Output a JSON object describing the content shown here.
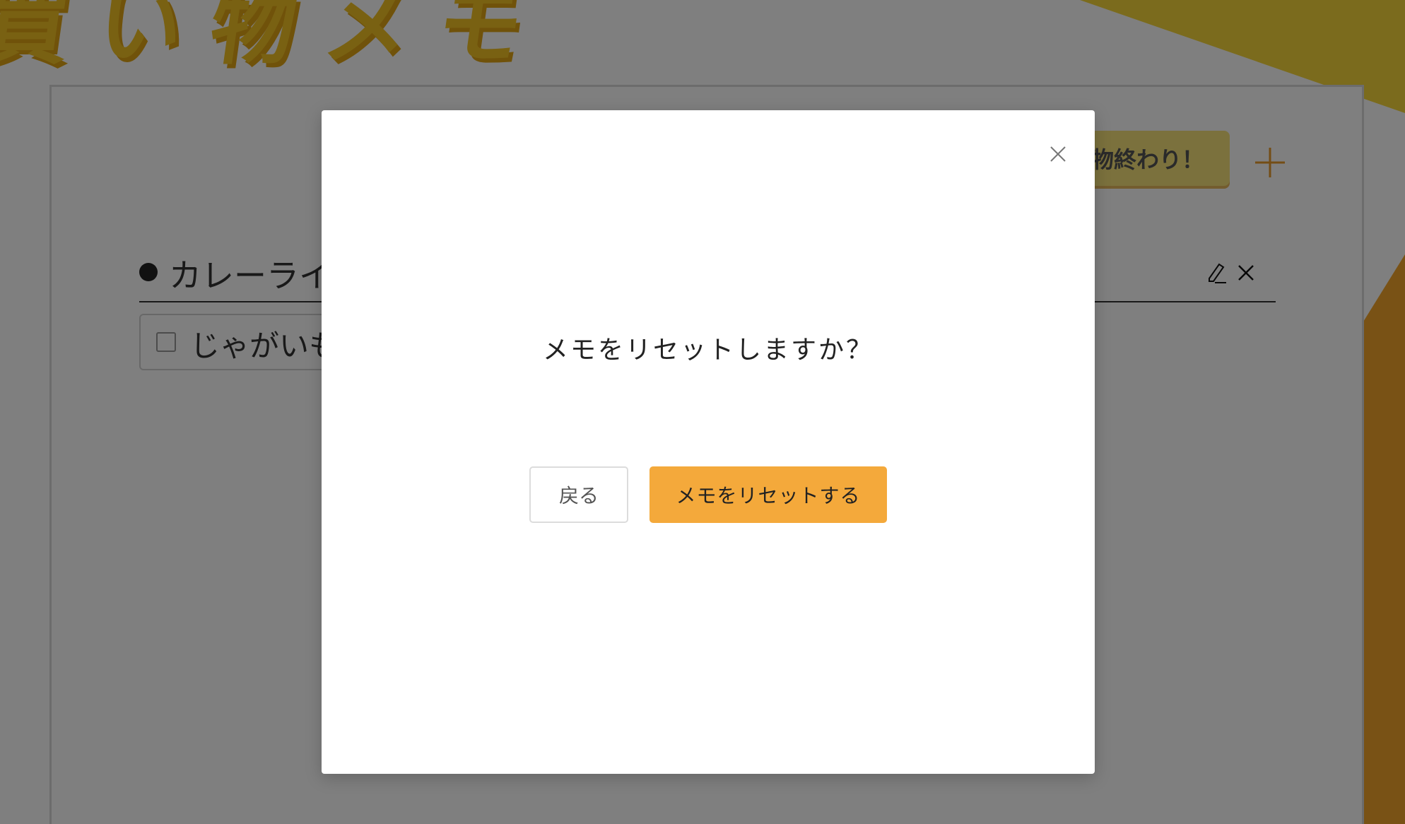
{
  "page": {
    "title": "買い物メモ"
  },
  "toolbar": {
    "done_label": "物終わり！",
    "add_icon": "plus-icon"
  },
  "list": {
    "title": "カレーライ",
    "edit_icon": "pencil-icon",
    "delete_icon": "close-icon",
    "items": [
      {
        "label": "じゃがいも",
        "checked": false
      }
    ]
  },
  "modal": {
    "message": "メモをリセットしますか？",
    "close_icon": "close-icon",
    "back_label": "戻る",
    "confirm_label": "メモをリセットする"
  },
  "colors": {
    "accent": "#f4a93b",
    "title_yellow": "#f3c225",
    "overlay": "rgba(0,0,0,0.5)"
  }
}
